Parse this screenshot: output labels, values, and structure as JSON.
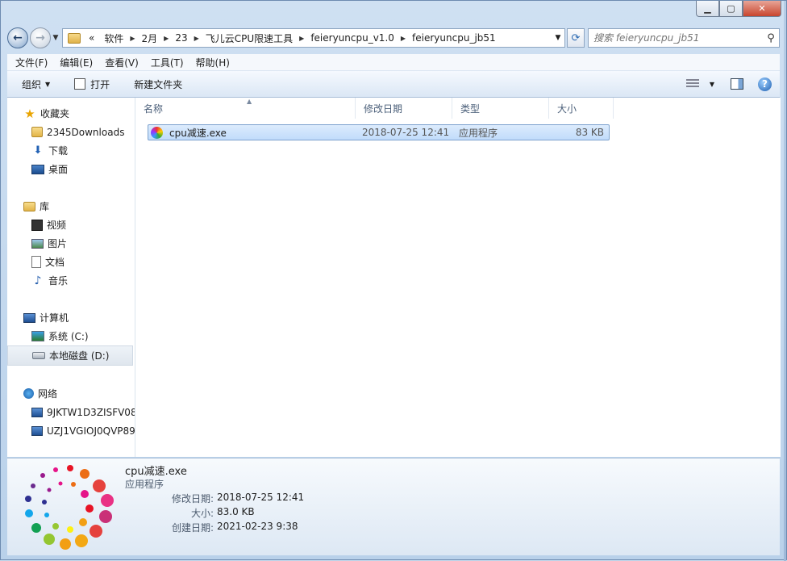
{
  "address": {
    "overflow_glyph": "«",
    "crumbs": [
      "软件",
      "2月",
      "23",
      "飞儿云CPU限速工具",
      "feieryuncpu_v1.0",
      "feieryuncpu_jb51"
    ]
  },
  "search": {
    "placeholder": "搜索 feieryuncpu_jb51"
  },
  "menu": [
    "文件(F)",
    "编辑(E)",
    "查看(V)",
    "工具(T)",
    "帮助(H)"
  ],
  "toolbar": {
    "organize": "组织",
    "open": "打开",
    "new_folder": "新建文件夹"
  },
  "nav": {
    "favorites": {
      "label": "收藏夹",
      "items": [
        "2345Downloads",
        "下载",
        "桌面"
      ]
    },
    "libraries": {
      "label": "库",
      "items": [
        "视频",
        "图片",
        "文档",
        "音乐"
      ]
    },
    "computer": {
      "label": "计算机",
      "items": [
        "系统 (C:)",
        "本地磁盘 (D:)"
      ]
    },
    "network": {
      "label": "网络",
      "items": [
        "9JKTW1D3ZISFV08",
        "UZJ1VGIOJ0QVP89"
      ]
    }
  },
  "columns": [
    "名称",
    "修改日期",
    "类型",
    "大小"
  ],
  "files": [
    {
      "name": "cpu减速.exe",
      "modified": "2018-07-25 12:41",
      "type": "应用程序",
      "size": "83 KB"
    }
  ],
  "details": {
    "title": "cpu减速.exe",
    "type": "应用程序",
    "props": [
      {
        "key": "修改日期:",
        "value": "2018-07-25 12:41"
      },
      {
        "key": "大小:",
        "value": "83.0 KB"
      },
      {
        "key": "创建日期:",
        "value": "2021-02-23 9:38"
      }
    ]
  },
  "colors": {
    "selection": "#cce0fa",
    "accent": "#2d6bb2"
  },
  "icons": [
    "back-icon",
    "forward-icon",
    "refresh-icon",
    "search-icon",
    "help-icon",
    "star-icon",
    "folder-icon"
  ]
}
